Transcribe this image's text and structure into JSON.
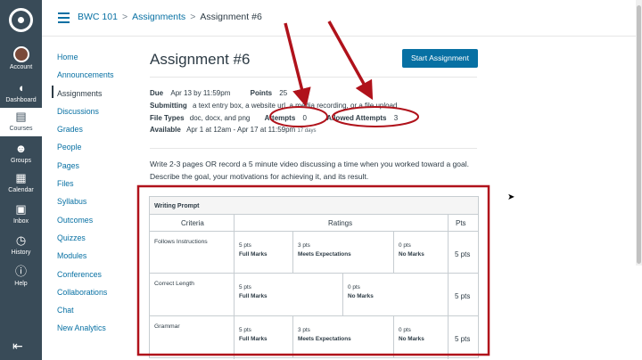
{
  "global_nav": {
    "items": [
      {
        "label": "Account",
        "icon": "avatar"
      },
      {
        "label": "Dashboard",
        "icon": "dashboard-icon"
      },
      {
        "label": "Courses",
        "icon": "book-icon"
      },
      {
        "label": "Groups",
        "icon": "groups-icon"
      },
      {
        "label": "Calendar",
        "icon": "calendar-icon"
      },
      {
        "label": "Inbox",
        "icon": "inbox-icon"
      },
      {
        "label": "History",
        "icon": "clock-icon"
      },
      {
        "label": "Help",
        "icon": "help-icon"
      }
    ]
  },
  "breadcrumb": {
    "course": "BWC 101",
    "section": "Assignments",
    "current": "Assignment #6",
    "separator": ">"
  },
  "course_nav": [
    "Home",
    "Announcements",
    "Assignments",
    "Discussions",
    "Grades",
    "People",
    "Pages",
    "Files",
    "Syllabus",
    "Outcomes",
    "Quizzes",
    "Modules",
    "Conferences",
    "Collaborations",
    "Chat",
    "New Analytics"
  ],
  "assignment": {
    "title": "Assignment #6",
    "start_button": "Start Assignment",
    "due_label": "Due",
    "due_value": "Apr 13 by 11:59pm",
    "points_label": "Points",
    "points_value": "25",
    "submitting_label": "Submitting",
    "submitting_value": "a text entry box, a website url, a media recording, or a file upload",
    "filetypes_label": "File Types",
    "filetypes_value": "doc, docx, and png",
    "attempts_label": "Attempts",
    "attempts_value": "0",
    "allowed_label": "Allowed Attempts",
    "allowed_value": "3",
    "available_label": "Available",
    "available_value": "Apr 1 at 12am - Apr 17 at 11:59pm",
    "available_days": "17 days",
    "description": "Write 2-3 pages OR record a 5 minute video discussing a time when you worked toward a goal. Describe the goal, your motivations for achieving it, and its result."
  },
  "rubric": {
    "title": "Writing Prompt",
    "col_criteria": "Criteria",
    "col_ratings": "Ratings",
    "col_pts": "Pts",
    "rows": [
      {
        "criterion": "Follows Instructions",
        "total": "5 pts",
        "ratings": [
          {
            "pts": "5 pts",
            "desc": "Full Marks"
          },
          {
            "pts": "3 pts",
            "desc": "Meets Expectations"
          },
          {
            "pts": "0 pts",
            "desc": "No Marks"
          }
        ]
      },
      {
        "criterion": "Correct Length",
        "total": "5 pts",
        "ratings": [
          {
            "pts": "5 pts",
            "desc": "Full Marks"
          },
          {
            "pts": "0 pts",
            "desc": "No Marks"
          }
        ]
      },
      {
        "criterion": "Grammar",
        "total": "5 pts",
        "ratings": [
          {
            "pts": "5 pts",
            "desc": "Full Marks"
          },
          {
            "pts": "3 pts",
            "desc": "Meets Expectations"
          },
          {
            "pts": "0 pts",
            "desc": "No Marks"
          }
        ]
      }
    ]
  },
  "colors": {
    "nav_bg": "#394b58",
    "link": "#0770a3",
    "annotation": "#b0121b"
  }
}
